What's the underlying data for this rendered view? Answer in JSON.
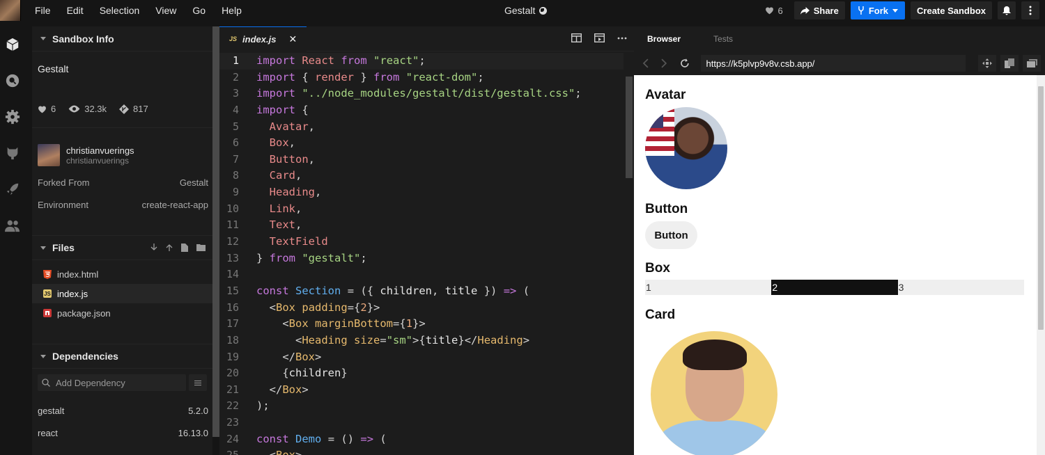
{
  "menu": [
    "File",
    "Edit",
    "Selection",
    "View",
    "Go",
    "Help"
  ],
  "title": "Gestalt",
  "top_right": {
    "likes": "6",
    "share": "Share",
    "fork": "Fork",
    "create": "Create Sandbox"
  },
  "sidebar": {
    "sandbox_info_label": "Sandbox Info",
    "sandbox_title": "Gestalt",
    "stats": {
      "likes": "6",
      "views": "32.3k",
      "forks": "817"
    },
    "user": {
      "name": "christianvuerings",
      "handle": "christianvuerings"
    },
    "forked_from_label": "Forked From",
    "forked_from_value": "Gestalt",
    "environment_label": "Environment",
    "environment_value": "create-react-app",
    "files_label": "Files",
    "files": [
      {
        "name": "index.html",
        "icon": "html-icon"
      },
      {
        "name": "index.js",
        "icon": "js-icon"
      },
      {
        "name": "package.json",
        "icon": "npm-icon"
      }
    ],
    "dependencies_label": "Dependencies",
    "add_dependency_placeholder": "Add Dependency",
    "dependencies": [
      {
        "name": "gestalt",
        "version": "5.2.0"
      },
      {
        "name": "react",
        "version": "16.13.0"
      }
    ]
  },
  "editor": {
    "tab_label": "index.js",
    "tab_prefix": "JS",
    "line_numbers": [
      "1",
      "2",
      "3",
      "4",
      "5",
      "6",
      "7",
      "8",
      "9",
      "10",
      "11",
      "12",
      "13",
      "14",
      "15",
      "16",
      "17",
      "18",
      "19",
      "20",
      "21",
      "22",
      "23",
      "24",
      "25"
    ],
    "code_lines": [
      "import React from \"react\";",
      "import { render } from \"react-dom\";",
      "import \"../node_modules/gestalt/dist/gestalt.css\";",
      "import {",
      "  Avatar,",
      "  Box,",
      "  Button,",
      "  Card,",
      "  Heading,",
      "  Link,",
      "  Text,",
      "  TextField",
      "} from \"gestalt\";",
      "",
      "const Section = ({ children, title }) => (",
      "  <Box padding={2}>",
      "    <Box marginBottom={1}>",
      "      <Heading size=\"sm\">{title}</Heading>",
      "    </Box>",
      "    {children}",
      "  </Box>",
      ");",
      "",
      "const Demo = () => (",
      "  <Box>"
    ]
  },
  "browser": {
    "tab_browser": "Browser",
    "tab_tests": "Tests",
    "url": "https://k5plvp9v8v.csb.app/",
    "headings": {
      "avatar": "Avatar",
      "button": "Button",
      "box": "Box",
      "card": "Card"
    },
    "button_label": "Button",
    "box_cells": [
      "1",
      "2",
      "3"
    ]
  },
  "colors": {
    "accent": "#0971f1",
    "bg": "#151515",
    "panel": "#1c1c1c"
  }
}
